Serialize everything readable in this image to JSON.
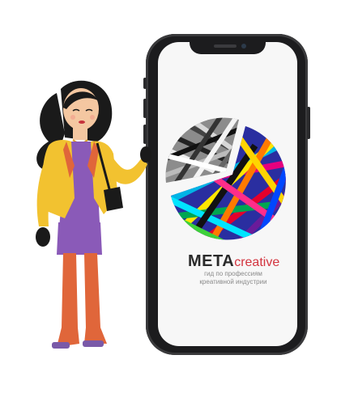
{
  "brand": {
    "name_bold": "META",
    "name_light": "creative",
    "tagline_line1": "гид по профессиям",
    "tagline_line2": "креативной индустрии"
  },
  "colors": {
    "phone_body": "#1c1c1e",
    "screen": "#f7f7f7",
    "brand_text": "#2a2a2a",
    "brand_accent": "#d3343f",
    "jacket": "#f2c230",
    "dress": "#8a5ab8",
    "boots": "#e0663a",
    "hair": "#1a1a1a",
    "skin": "#f4c7a1"
  },
  "icons": [
    "phone-illustration",
    "pie-logo-icon",
    "woman-illustration"
  ]
}
